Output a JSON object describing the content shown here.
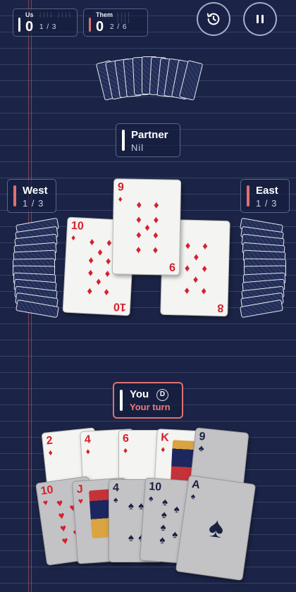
{
  "score": {
    "us": {
      "label": "Us",
      "points": "0",
      "bags": "1 / 3",
      "ticks": "|||| ||||"
    },
    "them": {
      "label": "Them",
      "points": "0",
      "bags": "2 / 6",
      "ticks": "|||| ||||"
    }
  },
  "controls": {
    "history_icon": "history-icon",
    "pause_icon": "pause-icon"
  },
  "players": {
    "partner": {
      "name": "Partner",
      "bid": "Nil"
    },
    "west": {
      "name": "West",
      "tricks": "1 / 3"
    },
    "east": {
      "name": "East",
      "tricks": "1 / 3"
    },
    "you": {
      "name": "You",
      "dealer": "D",
      "status": "Your turn"
    }
  },
  "trick": [
    {
      "player": "west",
      "rank": "10",
      "suit": "♦"
    },
    {
      "player": "partner",
      "rank": "9",
      "suit": "♦"
    },
    {
      "player": "east",
      "rank": "8",
      "suit": "♦"
    }
  ],
  "hand": {
    "playable": [
      {
        "rank": "2",
        "suit": "♦"
      },
      {
        "rank": "4",
        "suit": "♦"
      },
      {
        "rank": "6",
        "suit": "♦"
      },
      {
        "rank": "K",
        "suit": "♦"
      }
    ],
    "unplayable": [
      {
        "rank": "9",
        "suit": "♣"
      },
      {
        "rank": "10",
        "suit": "♥"
      },
      {
        "rank": "J",
        "suit": "♥"
      },
      {
        "rank": "4",
        "suit": "♠"
      },
      {
        "rank": "10",
        "suit": "♠"
      },
      {
        "rank": "A",
        "suit": "♠"
      }
    ]
  },
  "colors": {
    "background": "#1b2446",
    "accent": "#e07070",
    "red_suit": "#d4212c",
    "black_suit": "#1b2140"
  }
}
